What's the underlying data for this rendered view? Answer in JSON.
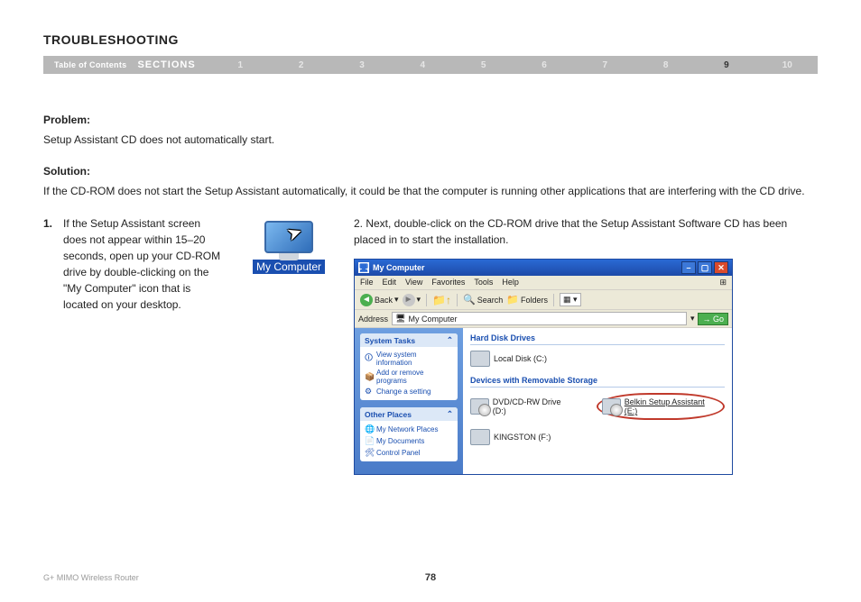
{
  "page": {
    "title": "TROUBLESHOOTING",
    "product": "G+ MIMO Wireless Router",
    "number": "78"
  },
  "nav": {
    "toc_label": "Table of Contents",
    "sections_label": "SECTIONS",
    "items": [
      "1",
      "2",
      "3",
      "4",
      "5",
      "6",
      "7",
      "8",
      "9",
      "10"
    ],
    "active": "9"
  },
  "content": {
    "problem_label": "Problem:",
    "problem_text": "Setup Assistant CD does not automatically start.",
    "solution_label": "Solution:",
    "solution_text": "If the CD-ROM does not start the Setup Assistant automatically, it could be that the computer is running other applications that are interfering with the CD drive.",
    "step1_num": "1.",
    "step1_text": "If the Setup Assistant screen does not appear within 15–20 seconds, open up your CD-ROM drive by double-clicking on the \"My Computer\" icon that is located on your desktop.",
    "step2_text": "2. Next, double-click on the CD-ROM drive that the Setup Assistant Software CD has been placed in to start the installation.",
    "my_computer_label": "My Computer"
  },
  "xp": {
    "title": "My Computer",
    "menu": [
      "File",
      "Edit",
      "View",
      "Favorites",
      "Tools",
      "Help"
    ],
    "toolbar": {
      "back": "Back",
      "search": "Search",
      "folders": "Folders"
    },
    "address_label": "Address",
    "address_value": "My Computer",
    "go": "Go",
    "sidebar": {
      "system_tasks": {
        "title": "System Tasks",
        "items": [
          "View system information",
          "Add or remove programs",
          "Change a setting"
        ]
      },
      "other_places": {
        "title": "Other Places",
        "items": [
          "My Network Places",
          "My Documents",
          "Control Panel"
        ]
      }
    },
    "main": {
      "group1": "Hard Disk Drives",
      "drive1": "Local Disk (C:)",
      "group2": "Devices with Removable Storage",
      "drive2": "DVD/CD-RW Drive (D:)",
      "drive3": "Belkin Setup Assistant (E:)",
      "drive4": "KINGSTON (F:)"
    }
  }
}
